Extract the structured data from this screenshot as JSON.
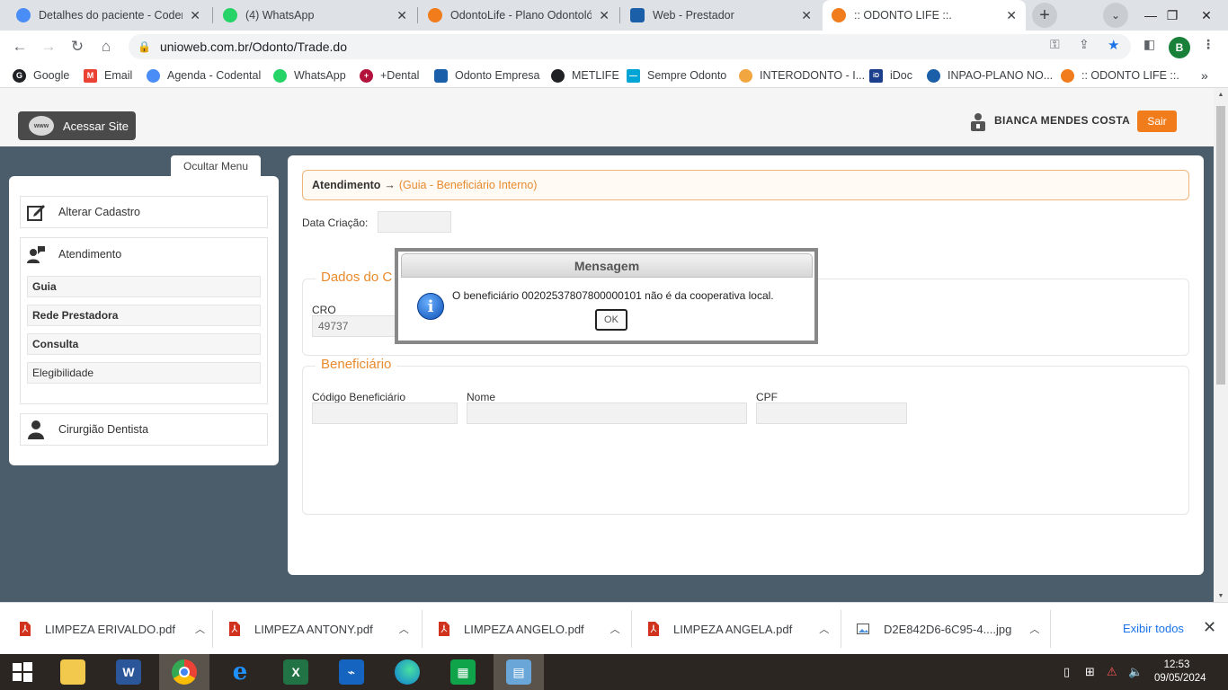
{
  "browser": {
    "tabs": [
      {
        "title": "Detalhes do paciente - Codental",
        "favicon_color": "#4a8df6",
        "active": false
      },
      {
        "title": "(4) WhatsApp",
        "favicon_color": "#25d366",
        "active": false
      },
      {
        "title": "OdontoLife - Plano Odontológico",
        "favicon_color": "#f07c1b",
        "active": false
      },
      {
        "title": "Web - Prestador",
        "favicon_color": "#1b5fa8",
        "active": false
      },
      {
        "title": ":: ODONTO LIFE ::.",
        "favicon_color": "#f07c1b",
        "active": true
      }
    ],
    "url": "unioweb.com.br/Odonto/Trade.do",
    "profile_initial": "B",
    "bookmarks": [
      {
        "label": "Google",
        "color": "#202124",
        "icon": "google-icon"
      },
      {
        "label": "Email",
        "color": "#ea4335",
        "icon": "gmail-icon"
      },
      {
        "label": "Agenda - Codental",
        "color": "#4a8df6",
        "icon": "codental-icon"
      },
      {
        "label": "WhatsApp",
        "color": "#25d366",
        "icon": "whatsapp-icon"
      },
      {
        "label": "+Dental",
        "color": "#b3123a",
        "icon": "dental-icon"
      },
      {
        "label": "Odonto Empresa",
        "color": "#1b5fa8",
        "icon": "tooth-icon"
      },
      {
        "label": "METLIFE",
        "color": "#202124",
        "icon": "metlife-icon"
      },
      {
        "label": "Sempre Odonto",
        "color": "#00a5d6",
        "icon": "sempre-odonto-icon"
      },
      {
        "label": "INTERODONTO - I...",
        "color": "#f2a640",
        "icon": "interodonto-icon"
      },
      {
        "label": "iDoc",
        "color": "#1b3f8c",
        "icon": "idoc-icon"
      },
      {
        "label": "INPAO-PLANO NO...",
        "color": "#1b5fa8",
        "icon": "inpao-icon"
      },
      {
        "label": ":: ODONTO LIFE ::.",
        "color": "#f07c1b",
        "icon": "odontolife-icon"
      }
    ]
  },
  "header": {
    "site_button": "Acessar Site",
    "www_badge": "www",
    "user_name": "BIANCA MENDES COSTA",
    "logout": "Sair"
  },
  "sidebar": {
    "toggle": "Ocultar Menu",
    "items": [
      {
        "label": "Alterar Cadastro",
        "icon": "edit-icon"
      },
      {
        "label": "Atendimento",
        "icon": "user-speech-icon",
        "children": [
          {
            "label": "Guia",
            "bold": true
          },
          {
            "label": "Rede Prestadora",
            "bold": true
          },
          {
            "label": "Consulta",
            "bold": true
          },
          {
            "label": "Elegibilidade",
            "bold": false
          }
        ]
      },
      {
        "label": "Cirurgião Dentista",
        "icon": "person-icon"
      }
    ]
  },
  "main": {
    "breadcrumb": {
      "section": "Atendimento",
      "arrow": "→",
      "page": "(Guia - Beneficiário Interno)"
    },
    "data_criacao_label": "Data Criação:",
    "data_criacao_value": "",
    "dados_legend": "Dados do C",
    "cro_label": "CRO",
    "cro_value": "49737",
    "beneficiario_legend": "Beneficiário",
    "codigo_label": "Código Beneficiário",
    "nome_label": "Nome",
    "cpf_label": "CPF"
  },
  "modal": {
    "title": "Mensagem",
    "message": "O beneficiário 00202537807800000101 não é da cooperativa local.",
    "ok": "OK",
    "info_glyph": "i"
  },
  "downloads": {
    "files": [
      {
        "name": "LIMPEZA ERIVALDO.pdf",
        "type": "pdf"
      },
      {
        "name": "LIMPEZA ANTONY.pdf",
        "type": "pdf"
      },
      {
        "name": "LIMPEZA ANGELO.pdf",
        "type": "pdf"
      },
      {
        "name": "LIMPEZA ANGELA.pdf",
        "type": "pdf"
      },
      {
        "name": "D2E842D6-6C95-4....jpg",
        "type": "image"
      }
    ],
    "show_all": "Exibir todos"
  },
  "taskbar": {
    "apps": [
      {
        "name": "windows-start",
        "color": "#ffffff"
      },
      {
        "name": "file-explorer",
        "color": "#f2c94c"
      },
      {
        "name": "word",
        "color": "#2b579a"
      },
      {
        "name": "chrome",
        "color": "#4285f4"
      },
      {
        "name": "internet-explorer",
        "color": "#1e90ff"
      },
      {
        "name": "excel",
        "color": "#217346"
      },
      {
        "name": "scanner",
        "color": "#1565c0"
      },
      {
        "name": "edge",
        "color": "#0c7bd6"
      },
      {
        "name": "store",
        "color": "#0fa34a"
      },
      {
        "name": "control-panel",
        "color": "#6aa6d8"
      }
    ],
    "time": "12:53",
    "date": "09/05/2024"
  }
}
